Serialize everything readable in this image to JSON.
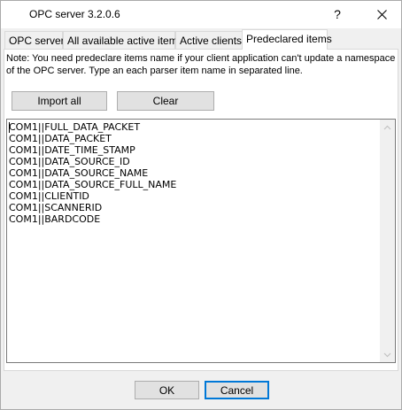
{
  "window": {
    "title": "OPC server 3.2.0.6",
    "help_label": "?"
  },
  "tabs": [
    {
      "label": "OPC server"
    },
    {
      "label": "All available active items"
    },
    {
      "label": "Active clients"
    },
    {
      "label": "Predeclared items"
    }
  ],
  "active_tab": "Predeclared items",
  "note": "Note: You need predeclare items name if your client application can't update a namespace of the OPC server. Type an each parser item name in separated line.",
  "buttons": {
    "import_all": "Import all",
    "clear": "Clear",
    "ok": "OK",
    "cancel": "Cancel"
  },
  "items": [
    "COM1||FULL_DATA_PACKET",
    "COM1||DATA_PACKET",
    "COM1||DATE_TIME_STAMP",
    "COM1||DATA_SOURCE_ID",
    "COM1||DATA_SOURCE_NAME",
    "COM1||DATA_SOURCE_FULL_NAME",
    "COM1||CLIENTID",
    "COM1||SCANNERID",
    "COM1||BARDCODE"
  ],
  "colors": {
    "focus_border": "#0078d7",
    "button_face": "#e1e1e1",
    "window_bg": "#f0f0f0"
  }
}
